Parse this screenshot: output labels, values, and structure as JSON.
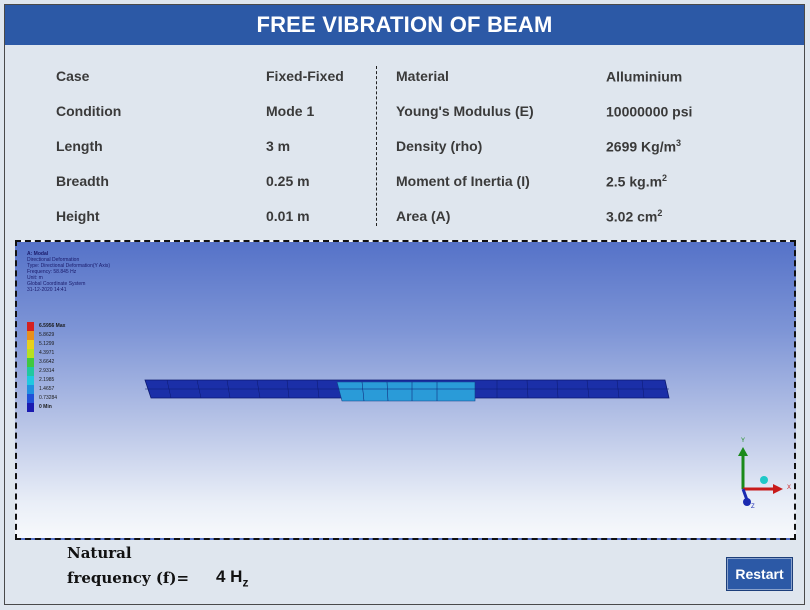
{
  "title": "FREE VIBRATION OF BEAM",
  "params": {
    "left": [
      {
        "label": "Case",
        "value": "Fixed-Fixed"
      },
      {
        "label": "Condition",
        "value": "Mode 1"
      },
      {
        "label": "Length",
        "value": "3 m"
      },
      {
        "label": "Breadth",
        "value": "0.25 m"
      },
      {
        "label": "Height",
        "value": "0.01 m"
      }
    ],
    "right": [
      {
        "label": "Material",
        "value": "Alluminium",
        "unit_sup": ""
      },
      {
        "label": "Young's Modulus (E)",
        "value": "10000000 psi",
        "unit_sup": ""
      },
      {
        "label": "Density (rho)",
        "value": "2699 Kg/m",
        "unit_sup": "3"
      },
      {
        "label": "Moment of Inertia (I)",
        "value": "2.5 kg.m",
        "unit_sup": "2"
      },
      {
        "label": "Area (A)",
        "value": "3.02 cm",
        "unit_sup": "2"
      }
    ]
  },
  "viewport": {
    "info_lines": [
      "A: Modal",
      "Directional Deformation",
      "Type: Directional Deformation(Y Axis)",
      "Frequency: 58.845 Hz",
      "Unit: m",
      "Global Coordinate System",
      "31-12-2020 14:41"
    ],
    "legend": [
      {
        "label": "6.5956 Max",
        "color": "#d42020"
      },
      {
        "label": "5.8629",
        "color": "#e8901c"
      },
      {
        "label": "5.1299",
        "color": "#e8d01c"
      },
      {
        "label": "4.3971",
        "color": "#b8e020"
      },
      {
        "label": "3.6642",
        "color": "#40c840"
      },
      {
        "label": "2.9314",
        "color": "#20c8a0"
      },
      {
        "label": "2.1985",
        "color": "#20c8e0"
      },
      {
        "label": "1.4657",
        "color": "#2090e0"
      },
      {
        "label": "0.73284",
        "color": "#2050d8"
      },
      {
        "label": "0 Min",
        "color": "#1a1ab0"
      }
    ],
    "axes": {
      "x": "X",
      "y": "Y",
      "z": "Z"
    },
    "beam_colors": {
      "edge": "#1b2fa8",
      "middle": "#2a9bd8"
    }
  },
  "footer": {
    "natural_label": "Natural",
    "frequency_label": "frequency (f)=",
    "frequency_value": "4 H",
    "frequency_sub": "z",
    "restart_label": "Restart"
  }
}
